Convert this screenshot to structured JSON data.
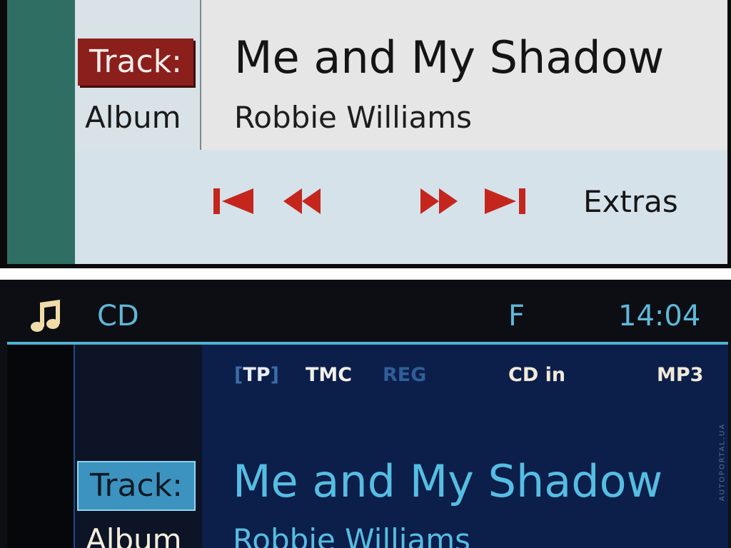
{
  "day_screen": {
    "labels": {
      "track": "Track:",
      "album": "Album"
    },
    "now_playing": {
      "title": "Me and My Shadow",
      "artist": "Robbie Williams"
    },
    "controls": {
      "prev_track_icon": "skip-back-icon",
      "rewind_icon": "rewind-icon",
      "fast_forward_icon": "fast-forward-icon",
      "next_track_icon": "skip-forward-icon",
      "extras_label": "Extras"
    },
    "colors": {
      "accent": "#8a1f1c",
      "control_red": "#c4261d",
      "background": "#e6e6e6"
    }
  },
  "night_screen": {
    "status_bar": {
      "icon": "music-note-icon",
      "source": "CD",
      "fm_indicator": "F",
      "time": "14:04"
    },
    "indicators": {
      "tp_open": "[",
      "tp": "TP",
      "tp_close": "]",
      "tmc": "TMC",
      "reg": "REG",
      "cd_in": "CD in",
      "format": "MP3"
    },
    "labels": {
      "track": "Track:",
      "album": "Album"
    },
    "now_playing": {
      "title": "Me and My Shadow",
      "artist": "Robbie Williams"
    },
    "watermark": "AUTOPORTAL.UA",
    "colors": {
      "accent": "#3d93bf",
      "text": "#56bde2",
      "background": "#0c1e4a"
    }
  }
}
